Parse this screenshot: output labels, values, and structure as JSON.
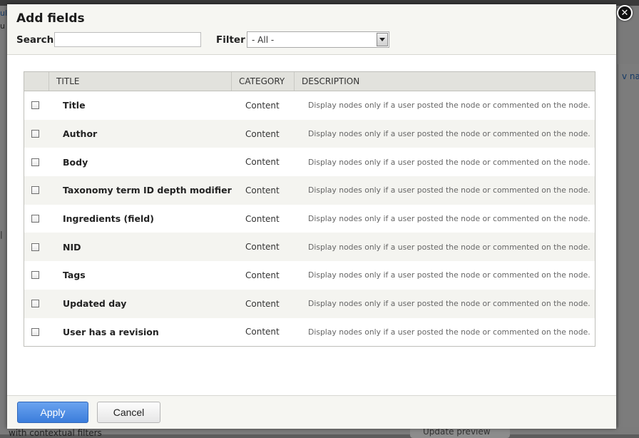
{
  "background": {
    "right_link": "v nam",
    "bottom_text": "with contextual filters",
    "bottom_button": "Update preview",
    "left_fragment_1": "ul",
    "left_fragment_2": "u",
    "left_fragment_3": "|"
  },
  "dialog": {
    "title": "Add fields",
    "close_symbol": "✕",
    "search": {
      "label": "Search",
      "value": "",
      "placeholder": ""
    },
    "filter": {
      "label": "Filter",
      "selected": "- All -"
    },
    "table": {
      "headers": {
        "title": "TITLE",
        "category": "CATEGORY",
        "description": "DESCRIPTION"
      },
      "rows": [
        {
          "title": "Title",
          "category": "Content",
          "description": "Display nodes only if a user posted the node or commented on the node."
        },
        {
          "title": "Author",
          "category": "Content",
          "description": "Display nodes only if a user posted the node or commented on the node."
        },
        {
          "title": "Body",
          "category": "Content",
          "description": "Display nodes only if a user posted the node or commented on the node."
        },
        {
          "title": "Taxonomy term ID depth modifier",
          "category": "Content",
          "description": "Display nodes only if a user posted the node or commented on the node."
        },
        {
          "title": "Ingredients (field)",
          "category": "Content",
          "description": "Display nodes only if a user posted the node or commented on the node."
        },
        {
          "title": "NID",
          "category": "Content",
          "description": "Display nodes only if a user posted the node or commented on the node."
        },
        {
          "title": "Tags",
          "category": "Content",
          "description": "Display nodes only if a user posted the node or commented on the node."
        },
        {
          "title": "Updated day",
          "category": "Content",
          "description": "Display nodes only if a user posted the node or commented on the node."
        },
        {
          "title": "User has a revision",
          "category": "Content",
          "description": "Display nodes only if a user posted the node or commented on the node."
        }
      ]
    },
    "footer": {
      "apply_label": "Apply",
      "cancel_label": "Cancel"
    }
  },
  "colors": {
    "apply_button": "#3b7ddb",
    "header_bg": "#f6f6f2",
    "row_alt_bg": "#f4f4f0"
  }
}
